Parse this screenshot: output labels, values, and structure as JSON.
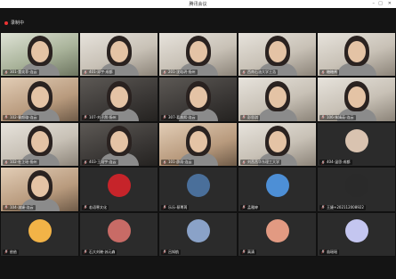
{
  "window": {
    "title": "腾讯会议"
  },
  "meeting": {
    "recording_label": "录制中"
  },
  "participants": [
    {
      "name": "301-董奕菲-连云",
      "type": "video",
      "tone": "green"
    },
    {
      "name": "401-邓宇-成都",
      "type": "video",
      "tone": "video"
    },
    {
      "name": "201-沈晗玥-扬州",
      "type": "video",
      "tone": "video"
    },
    {
      "name": "西南石油大学王浩",
      "type": "video",
      "tone": "video"
    },
    {
      "name": "糖糖酱",
      "type": "video",
      "tone": "video"
    },
    {
      "name": "102-曹颜璇-连云",
      "type": "video",
      "tone": "warm"
    },
    {
      "name": "107-刘子然-扬州",
      "type": "video",
      "tone": "dark"
    },
    {
      "name": "307-葛晨熙-连云",
      "type": "video",
      "tone": "dark"
    },
    {
      "name": "彭思淇",
      "type": "video",
      "tone": "video"
    },
    {
      "name": "106-朱婧茹-连云",
      "type": "video",
      "tone": "video"
    },
    {
      "name": "102-杜芷瑶-扬州",
      "type": "video",
      "tone": "video"
    },
    {
      "name": "403-王翔宇-连云",
      "type": "video",
      "tone": "dark"
    },
    {
      "name": "101-薛雨-连云",
      "type": "video",
      "tone": "warm"
    },
    {
      "name": "刘茜茜华东理工大学",
      "type": "video",
      "tone": "video"
    },
    {
      "name": "404-温思-成都",
      "type": "avatar",
      "color": "#d9c3b0"
    },
    {
      "name": "104-潘婕-连云",
      "type": "video",
      "tone": "warm"
    },
    {
      "name": "若语寒文化",
      "type": "avatar",
      "color": "#c6242a"
    },
    {
      "name": "乐乐-蔡菁苒",
      "type": "avatar",
      "color": "#4a6f9a"
    },
    {
      "name": "孟雅婷",
      "type": "avatar",
      "color": "#4d8fd6"
    },
    {
      "name": "王婕+202112008922",
      "type": "avatar",
      "color": "#2a2a2a"
    },
    {
      "name": "依依",
      "type": "avatar",
      "color": "#f2b347"
    },
    {
      "name": "石大刘晓-苏元森",
      "type": "avatar",
      "color": "#c86b66"
    },
    {
      "name": "吕知航",
      "type": "avatar",
      "color": "#8aa2c8"
    },
    {
      "name": "高清",
      "type": "avatar",
      "color": "#e29a82"
    },
    {
      "name": "翁瑶瑶",
      "type": "avatar",
      "color": "#c4c6f0"
    }
  ]
}
